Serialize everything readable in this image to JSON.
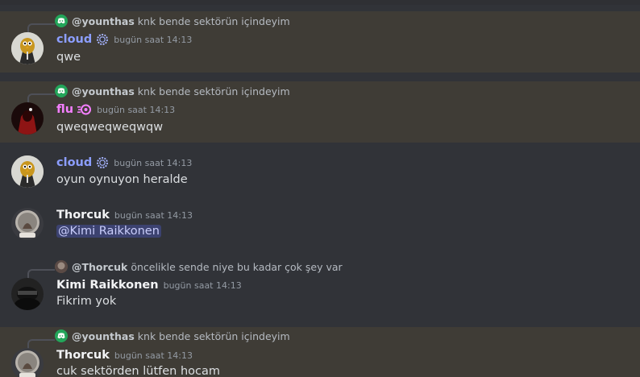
{
  "colors": {
    "background": "#313338",
    "highlight": "#3f3c36",
    "cloud": "#8c9eff",
    "flu": "#f47fff",
    "white_name": "#f2f3f5",
    "mention_bg": "#3c4270",
    "reply_icon": "#23a55a"
  },
  "messages": [
    {
      "highlighted": true,
      "reply": {
        "icon": "discord-icon",
        "author": "@younthas",
        "text": "knk bende sektörün içindeyim"
      },
      "author": "cloud",
      "author_color": "#8c9eff",
      "badge": "gear-badge-icon",
      "timestamp": "bugün saat 14:13",
      "text": "qwe"
    },
    {
      "highlighted": true,
      "reply": {
        "icon": "discord-icon",
        "author": "@younthas",
        "text": "knk bende sektörün içindeyim"
      },
      "author": "flu",
      "author_color": "#f47fff",
      "badge": "nitro-badge-icon",
      "timestamp": "bugün saat 14:13",
      "text": "qweqweqweqwqw"
    },
    {
      "highlighted": false,
      "author": "cloud",
      "author_color": "#8c9eff",
      "badge": "gear-badge-icon",
      "timestamp": "bugün saat 14:13",
      "text": "oyun oynuyon heralde"
    },
    {
      "highlighted": false,
      "author": "Thorcuk",
      "author_color": "#f2f3f5",
      "timestamp": "bugün saat 14:13",
      "mention": "@Kimi Raikkonen"
    },
    {
      "highlighted": false,
      "reply": {
        "icon": "avatar-icon",
        "author": "@Thorcuk",
        "text": "öncelikle sende niye bu kadar çok şey var"
      },
      "author": "Kimi Raikkonen",
      "author_color": "#f2f3f5",
      "timestamp": "bugün saat 14:13",
      "text": "Fikrim yok"
    },
    {
      "highlighted": true,
      "reply": {
        "icon": "discord-icon",
        "author": "@younthas",
        "text": "knk bende sektörün içindeyim"
      },
      "author": "Thorcuk",
      "author_color": "#f2f3f5",
      "timestamp": "bugün saat 14:13",
      "text": "cuk sektörden lütfen hocam"
    }
  ]
}
